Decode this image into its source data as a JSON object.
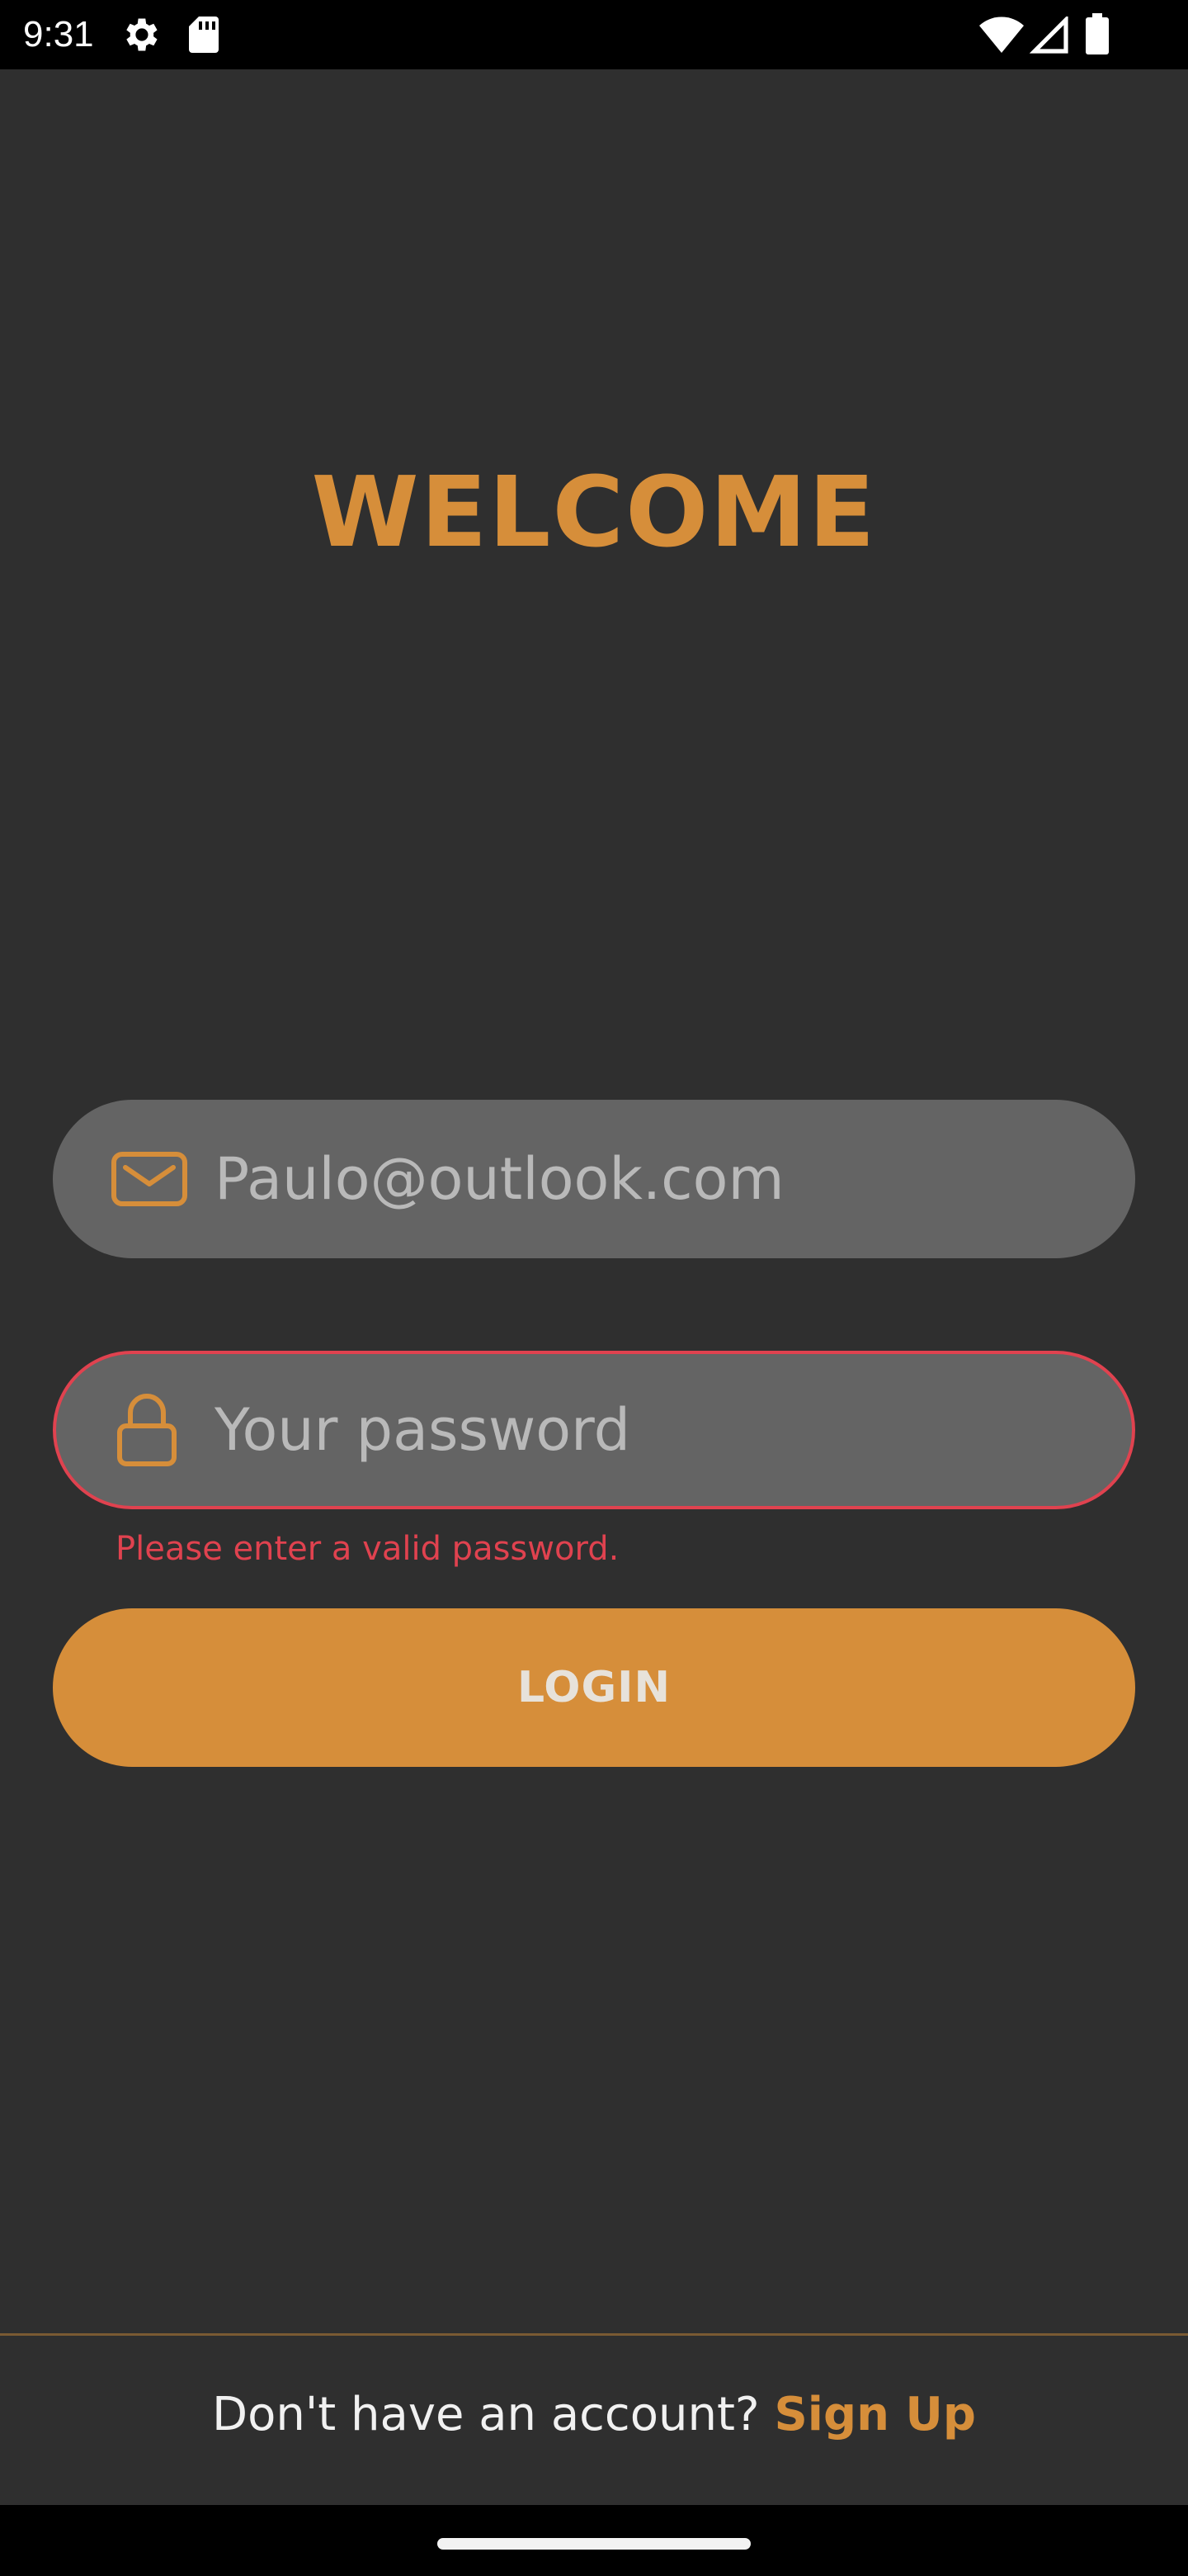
{
  "status_bar": {
    "time": "9:31",
    "icons": [
      "settings-icon",
      "sd-card-icon",
      "wifi-icon",
      "cellular-signal-icon",
      "battery-icon"
    ]
  },
  "title": "WELCOME",
  "email_field": {
    "value": "Paulo@outlook.com",
    "icon": "mail-icon"
  },
  "password_field": {
    "placeholder": "Your password",
    "icon": "lock-icon",
    "error": "Please enter a valid password."
  },
  "login_button": {
    "label": "LOGIN"
  },
  "footer": {
    "prompt": "Don't have an account? ",
    "signup_label": "Sign Up"
  },
  "colors": {
    "accent": "#d68e3a",
    "error": "#e0424f",
    "background": "#2f2f2f",
    "field": "#646464"
  }
}
